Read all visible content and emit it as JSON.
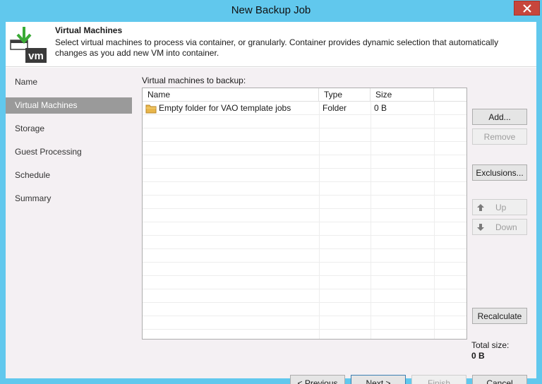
{
  "window": {
    "title": "New Backup Job"
  },
  "header": {
    "title": "Virtual Machines",
    "description": "Select virtual machines to process via container, or granularly. Container provides dynamic selection that automatically changes as you add new VM into container.",
    "icon": "vm-download-icon",
    "icon_text": "vm"
  },
  "sidebar": {
    "items": [
      {
        "label": "Name"
      },
      {
        "label": "Virtual Machines",
        "active": true
      },
      {
        "label": "Storage"
      },
      {
        "label": "Guest Processing"
      },
      {
        "label": "Schedule"
      },
      {
        "label": "Summary"
      }
    ]
  },
  "main": {
    "list_label": "Virtual machines to backup:",
    "columns": [
      "Name",
      "Type",
      "Size"
    ],
    "rows": [
      {
        "icon": "folder-icon",
        "name": "Empty folder for VAO template jobs",
        "type": "Folder",
        "size": "0 B"
      }
    ],
    "buttons": {
      "add": "Add...",
      "remove": "Remove",
      "exclusions": "Exclusions...",
      "up": "Up",
      "down": "Down",
      "recalculate": "Recalculate"
    },
    "total_label": "Total size:",
    "total_value": "0 B"
  },
  "footer": {
    "previous": "< Previous",
    "next": "Next >",
    "finish": "Finish",
    "cancel": "Cancel"
  },
  "colors": {
    "title_bar": "#61c8ed",
    "close_button": "#c7463c",
    "sidebar_active": "#9a9a9a",
    "panel_background": "#f4f0f3",
    "icon_green": "#3aaa35"
  }
}
